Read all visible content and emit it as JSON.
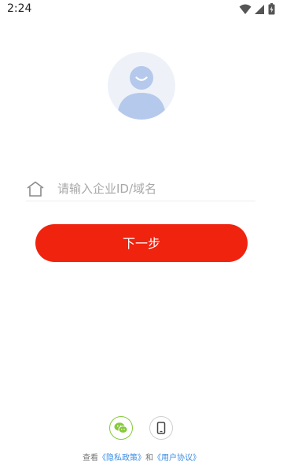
{
  "status_bar": {
    "time": "2:24"
  },
  "login": {
    "input_placeholder": "请输入企业ID/域名",
    "input_value": "",
    "next_button": "下一步"
  },
  "footer": {
    "prefix": "查看",
    "privacy_link": "《隐私政策》",
    "connector": "和",
    "agreement_link": "《用户协议》"
  },
  "icons": {
    "avatar": "user-avatar-icon",
    "input": "home-icon",
    "wechat": "wechat-icon",
    "phone": "phone-icon"
  },
  "colors": {
    "primary": "#f0230e",
    "wechat": "#86c93b",
    "link": "#3a8ee6",
    "avatar_fill": "#b5c9ec"
  }
}
